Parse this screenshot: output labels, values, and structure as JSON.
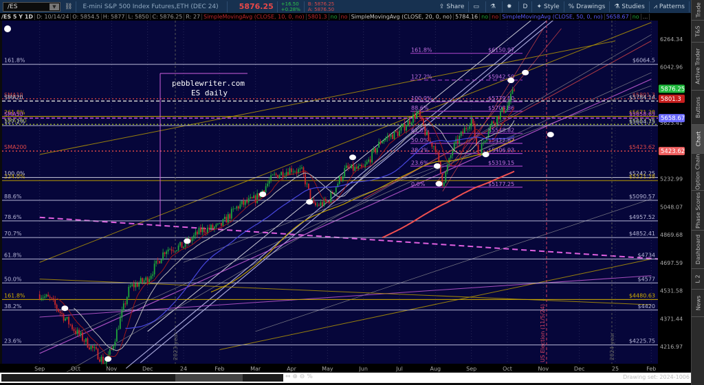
{
  "header": {
    "symbol": "/ES",
    "description": "E-mini S&P 500 Index Futures,ETH (DEC 24)",
    "last": "5876.25",
    "change": "+16.50",
    "change_pct": "+0.28%",
    "bid": "B: 5876.25",
    "ask": "A: 5876.50",
    "toolbar": [
      {
        "icon": "share-icon",
        "label": "Share"
      },
      {
        "icon": "alert-icon",
        "label": ""
      },
      {
        "icon": "flask-icon",
        "label": ""
      },
      {
        "icon": "gear-icon",
        "label": ""
      },
      {
        "icon": "period-icon",
        "label": "D"
      },
      {
        "icon": "style-icon",
        "label": "Style"
      },
      {
        "icon": "drawings-icon",
        "label": "Drawings"
      },
      {
        "icon": "studies-icon",
        "label": "Studies"
      },
      {
        "icon": "patterns-icon",
        "label": "Patterns"
      },
      {
        "icon": "menu-icon",
        "label": "☰"
      }
    ]
  },
  "studybar": {
    "title": "/ES 5 Y 1D",
    "date": "D: 10/14/24",
    "open": "O: 5854.5",
    "high": "H: 5877",
    "low": "L: 5850",
    "close": "C: 5876.25",
    "range": "R: 27",
    "sma10": "SimpleMovingAvg (CLOSE, 10, 0, no)",
    "sma10_val": "5801.3",
    "sma20": "SimpleMovingAvg (CLOSE, 20, 0, no)",
    "sma20_val": "5784.16",
    "sma50": "SimpleMovingAvg (CLOSE, 50, 0, no)",
    "sma50_val": "5658.67",
    "no": "no",
    "more": "..."
  },
  "chart_data": {
    "type": "candlestick",
    "scale": "log",
    "ylim": [
      4216.97,
      6264.34
    ],
    "y_ticks": [
      "6264.34",
      "6042.96",
      "5623.41",
      "5232.99",
      "5048.07",
      "4869.68",
      "4697.59",
      "4531.58",
      "4371.44",
      "4216.97"
    ],
    "x_ticks": [
      "Sep",
      "Oct",
      "Nov",
      "Dec",
      "24",
      "Feb",
      "Mar",
      "Apr",
      "May",
      "Jun",
      "Jul",
      "Aug",
      "Sep",
      "Oct",
      "Nov",
      "Dec",
      "25",
      "Feb"
    ],
    "price_path": [
      [
        0,
        4510
      ],
      [
        0.3,
        4480
      ],
      [
        0.6,
        4400
      ],
      [
        1,
        4300
      ],
      [
        1.5,
        4200
      ],
      [
        1.8,
        4130
      ],
      [
        2,
        4200
      ],
      [
        2.5,
        4550
      ],
      [
        3,
        4600
      ],
      [
        3.5,
        4780
      ],
      [
        4,
        4800
      ],
      [
        4.5,
        4900
      ],
      [
        5,
        4920
      ],
      [
        5.5,
        5050
      ],
      [
        6,
        5100
      ],
      [
        6.5,
        5250
      ],
      [
        7,
        5300
      ],
      [
        7.3,
        5280
      ],
      [
        7.6,
        5050
      ],
      [
        8,
        5080
      ],
      [
        8.5,
        5300
      ],
      [
        9,
        5300
      ],
      [
        9.5,
        5500
      ],
      [
        10,
        5560
      ],
      [
        10.5,
        5700
      ],
      [
        10.8,
        5500
      ],
      [
        11,
        5450
      ],
      [
        11.2,
        5200
      ],
      [
        11.5,
        5450
      ],
      [
        12,
        5650
      ],
      [
        12.2,
        5400
      ],
      [
        12.5,
        5600
      ],
      [
        13,
        5750
      ],
      [
        13.2,
        5876
      ]
    ],
    "levels": [
      {
        "price": 6064.5,
        "label": "$6064.5",
        "left": "161.8%",
        "color": "#b8b8d8",
        "style": "solid"
      },
      {
        "price": 5801.3,
        "label": "$5801.3",
        "left": "SMA10",
        "color": "#c04040",
        "style": "dot"
      },
      {
        "price": 5784.14,
        "label": "$5784.14",
        "left": "SMA20",
        "color": "#d0d0d0",
        "style": "dash"
      },
      {
        "price": 5671.38,
        "label": "$5671.38",
        "left": "261.8%",
        "color": "#d4b000",
        "style": "solid"
      },
      {
        "price": 5658.63,
        "label": "$5658.63",
        "left": "SMA50",
        "color": "#c050e0",
        "style": "dash"
      },
      {
        "price": 5613,
        "label": "$5613.15",
        "left": "SMA100",
        "color": "#8aa020",
        "style": "dot"
      },
      {
        "price": 5604.75,
        "label": "$5604.75",
        "left": "127.2%",
        "color": "#b8b8d8",
        "style": "solid"
      },
      {
        "price": 5423.62,
        "label": "$5423.62",
        "left": "SMA200",
        "color": "#e04848",
        "style": "dot"
      },
      {
        "price": 5242.25,
        "label": "$5242.25",
        "left": "100.0%",
        "color": "#d0d0e0",
        "style": "solid"
      },
      {
        "price": 5221.28,
        "label": "$5221.28",
        "left": "224.0%",
        "color": "#c0a000",
        "style": "solid"
      },
      {
        "price": 5090.57,
        "label": "$5090.57",
        "left": "88.6%",
        "color": "#b8b8d8",
        "style": "solid"
      },
      {
        "price": 4957.52,
        "label": "$4957.52",
        "left": "78.6%",
        "color": "#b8b8d8",
        "style": "solid"
      },
      {
        "price": 4852.41,
        "label": "$4852.41",
        "left": "70.7%",
        "color": "#b8b8d8",
        "style": "solid"
      },
      {
        "price": 4720,
        "label": "$4734",
        "left": "61.8%",
        "color": "#b8b8d8",
        "style": "solid"
      },
      {
        "price": 4577,
        "label": "$4577",
        "left": "50.0%",
        "color": "#b8b8d8",
        "style": "solid"
      },
      {
        "price": 4480.63,
        "label": "$4480.63",
        "left": "161.8%",
        "color": "#d4b000",
        "style": "solid"
      },
      {
        "price": 4420,
        "label": "$4420",
        "left": "38.2%",
        "color": "#b8b8d8",
        "style": "solid"
      },
      {
        "price": 4225.75,
        "label": "$4225.75",
        "left": "23.6%",
        "color": "#b8b8d8",
        "style": "solid"
      }
    ],
    "fib": [
      {
        "pct": "161.8%",
        "price": 6150.97
      },
      {
        "pct": "127.2%",
        "price": 5942.5
      },
      {
        "pct": "100.0%",
        "price": 5779.5
      },
      {
        "pct": "88.6%",
        "price": 5708.86
      },
      {
        "pct": "61.8%",
        "price": 5548.82
      },
      {
        "pct": "50.0%",
        "price": 5477.87
      },
      {
        "pct": "38.2%",
        "price": 5406.93
      },
      {
        "pct": "23.6%",
        "price": 5319.15
      },
      {
        "pct": "0.0%",
        "price": 5177.25
      }
    ],
    "price_tags": [
      {
        "value": "5876.25",
        "color": "#1fb83c"
      },
      {
        "value": "5801.3",
        "color": "#c81e1e"
      },
      {
        "value": "5658.67",
        "color": "#6a6aff"
      },
      {
        "value": "5423.62",
        "color": "#f06060"
      }
    ],
    "annotations": {
      "site": "pebblewriter.com",
      "subtitle": "ES daily",
      "election": "US Election (11/5/24)",
      "year2023": "2023 year",
      "year2024": "2024 year"
    }
  },
  "sidebar_tabs": [
    "Trade",
    "T&S",
    "Active Trader",
    "Buttons",
    "Chart",
    "Option Chain",
    "Phase Scores",
    "Dashboard",
    "L 2",
    "News"
  ],
  "footer": {
    "drawing_set": "Drawing set: 2024-1006"
  }
}
